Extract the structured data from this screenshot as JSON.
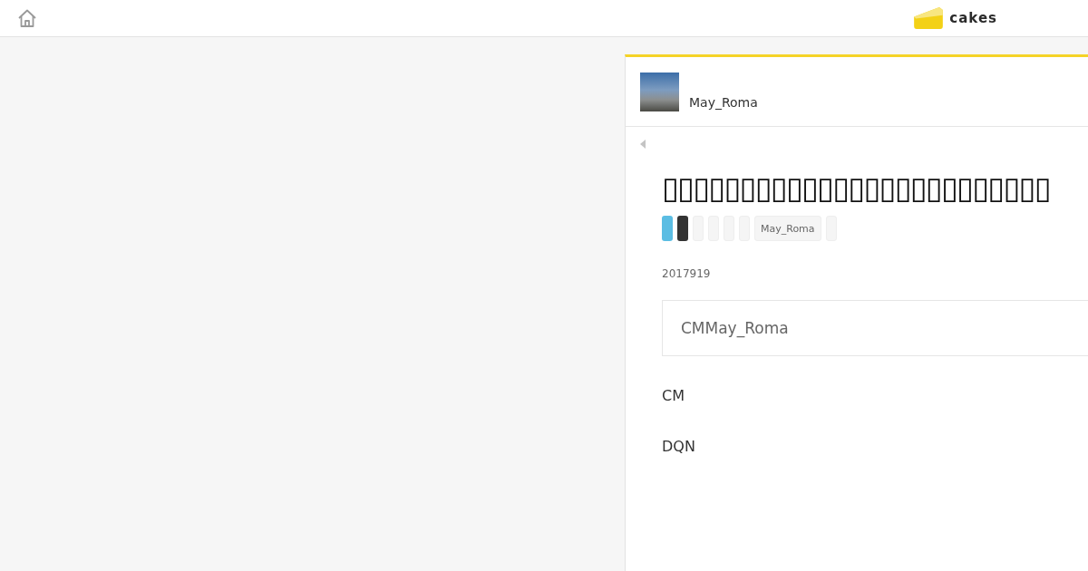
{
  "header": {
    "logo": {
      "text": "cakes"
    }
  },
  "author": {
    "name": "May_Roma"
  },
  "article": {
    "title": "▯▯▯▯▯▯▯▯▯▯▯▯▯▯▯▯▯▯▯▯▯▯▯▯▯",
    "tags": [
      {
        "color": "#5bbde3"
      },
      {
        "color": "#333333"
      },
      {
        "color": "#f5f5f5"
      },
      {
        "color": "#f5f5f5"
      },
      {
        "color": "#f5f5f5"
      },
      {
        "color": "#f5f5f5"
      },
      {
        "color": "#f5f5f5",
        "label": "May_Roma"
      },
      {
        "color": "#f5f5f5"
      }
    ],
    "date": "2017919",
    "quote": "CMMay_Roma",
    "paragraphs": [
      "CM",
      "DQN"
    ]
  }
}
